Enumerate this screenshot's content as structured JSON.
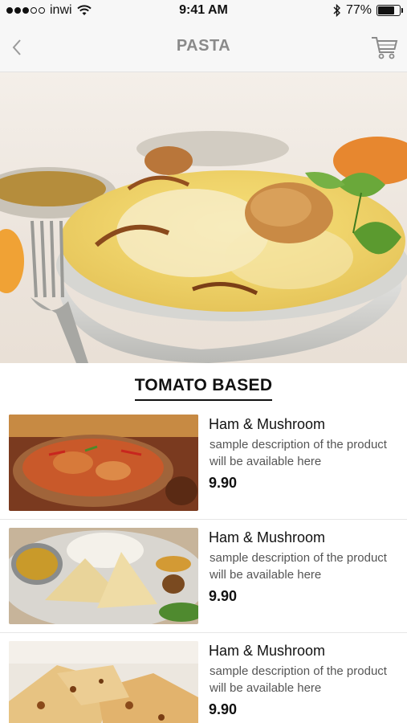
{
  "status_bar": {
    "carrier": "inwi",
    "time": "9:41 AM",
    "battery": "77%",
    "battery_level": 0.77
  },
  "nav": {
    "title": "PASTA",
    "back_icon": "chevron-left-icon",
    "cart_icon": "cart-icon"
  },
  "section": {
    "title": "TOMATO BASED"
  },
  "products": [
    {
      "name": "Ham & Mushroom",
      "description": "sample description of the product will be available here",
      "price": "9.90"
    },
    {
      "name": "Ham & Mushroom",
      "description": "sample description of the product will be available here",
      "price": "9.90"
    },
    {
      "name": "Ham & Mushroom",
      "description": "sample description of the product will be available here",
      "price": "9.90"
    }
  ],
  "colors": {
    "bar_background": "#f7f7f7",
    "title_gray": "#8a8a8a",
    "text": "#111111"
  }
}
